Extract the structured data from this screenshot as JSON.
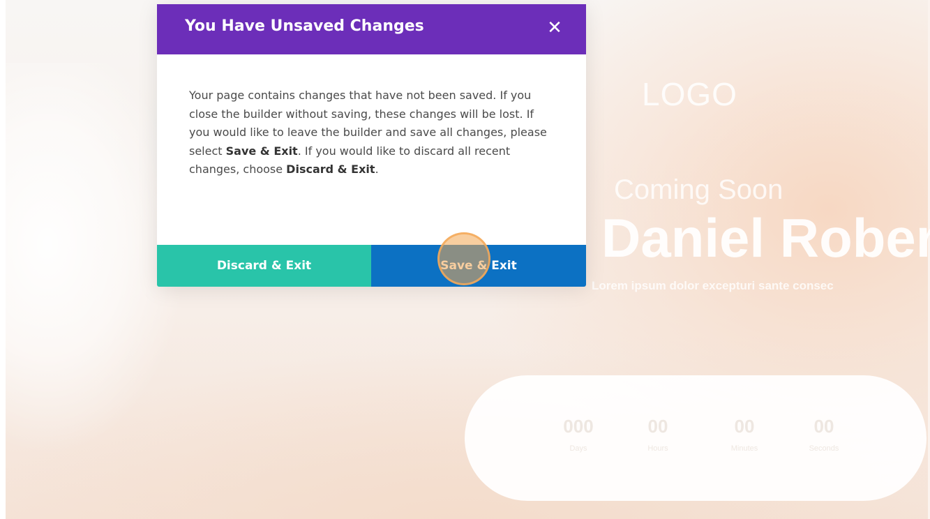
{
  "modal": {
    "title": "You Have Unsaved Changes",
    "close_icon": "close-icon",
    "body": {
      "intro": "Your page contains changes that have not been saved. If you close the builder without saving, these changes will be lost. If you would like to leave the builder and save all changes, please select ",
      "save_ref": "Save & Exit",
      "middle": ". If you would like to discard all recent changes, choose ",
      "discard_ref": "Discard & Exit",
      "end": "."
    },
    "discard_label": "Discard & Exit",
    "save_label": "Save & Exit"
  },
  "colors": {
    "header": "#6c2eb9",
    "discard": "#29c4a9",
    "save": "#0c71c3"
  },
  "background": {
    "logo": "LOGO",
    "coming_soon": "Coming Soon",
    "name": "Daniel Robert",
    "subtitle": "Lorem ipsum dolor excepturi sante consec",
    "countdown": [
      {
        "value": "000",
        "label": "Days"
      },
      {
        "value": "00",
        "label": "Hours"
      },
      {
        "value": "00",
        "label": "Minutes"
      },
      {
        "value": "00",
        "label": "Seconds"
      }
    ]
  }
}
